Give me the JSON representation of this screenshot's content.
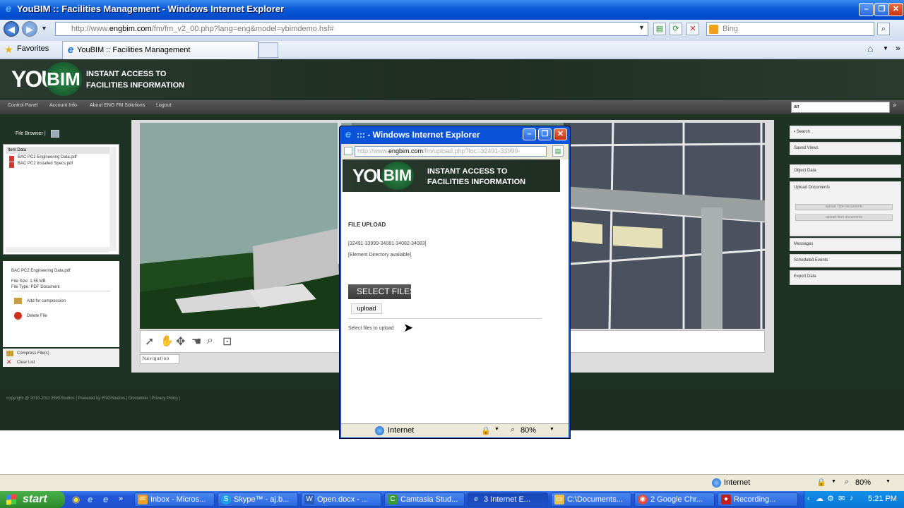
{
  "window": {
    "title": "YouBIM :: Facilities Management - Windows Internet Explorer"
  },
  "address_bar": {
    "url_prefix": "http://www.",
    "url_domain": "engbim.com",
    "url_rest": "/fm/fm_v2_00.php?lang=eng&model=ybimdemo.hsf#",
    "search_placeholder": "Bing"
  },
  "favorites": {
    "label": "Favorites",
    "tab_title": "YouBIM :: Facilities Management"
  },
  "site": {
    "logo_you": "YOU",
    "logo_bim": "BIM",
    "tagline_line1": "INSTANT ACCESS TO",
    "tagline_line2": "FACILITIES INFORMATION",
    "menu": [
      "Control Panel",
      "Account Info",
      "About ENG FM Solutions",
      "Logout"
    ],
    "search_value": "air",
    "footer": "copyright @ 2010-2011 ENGStudios | Powered by ENGStudios | Disclaimer | Privacy Policy |"
  },
  "file_browser": {
    "label": "File Browser |",
    "header": "Item Data",
    "files": [
      "BAC PC2 Engineering Data.pdf",
      "BAC PC2 Installed Specs.pdf"
    ]
  },
  "file_info": {
    "name": "BAC PC2 Engineering Data.pdf",
    "size": "File Size: 1.55 MB",
    "type": "File Type: PDF Document",
    "actions": [
      "Add for compression",
      "Delete File"
    ]
  },
  "list_tools": [
    "Compress File(s)",
    "Clear List"
  ],
  "viewer": {
    "nav_label": "Navigation"
  },
  "right_panel": {
    "sections_top": [
      "Search",
      "Saved Views",
      "Object Data",
      "Upload Documents"
    ],
    "upload_buttons": [
      "upload Type documents",
      "upload Item documents"
    ],
    "sections_bottom": [
      "Messages",
      "Scheduled Events",
      "Export Data"
    ]
  },
  "popup": {
    "title": "::: - Windows Internet Explorer",
    "url_prefix": "http://www.",
    "url_domain": "engbim.com",
    "url_rest": "/fm/upload.php?loc=32491-33999-",
    "heading": "FILE UPLOAD",
    "ids": "[32491-33999-34081-34082-34083]",
    "directory": "[Element Directory available]",
    "select_button": "SELECT FILES",
    "upload_button": "upload",
    "hint": "Select files to upload",
    "zone": "Internet",
    "zoom": "80%"
  },
  "status_bar": {
    "zone": "Internet",
    "zoom": "80%"
  },
  "taskbar": {
    "start": "start",
    "items": [
      "Inbox - Micros...",
      "Skype™ - aj.b...",
      "Open.docx - ...",
      "Camtasia Stud...",
      "3 Internet E...",
      "C:\\Documents...",
      "2 Google Chr...",
      "Recording..."
    ],
    "clock": "5:21 PM"
  }
}
